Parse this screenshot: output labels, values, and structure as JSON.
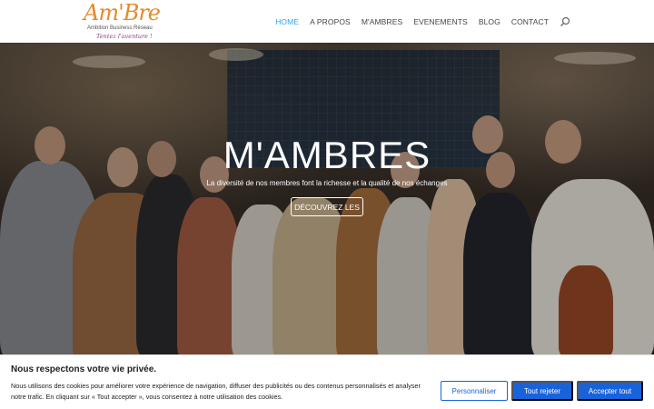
{
  "logo": {
    "script_text": "Am'Bre",
    "line1": "Ambition Business Réseau",
    "line2": "Tentez l'aventure !"
  },
  "nav": {
    "items": [
      {
        "label": "HOME",
        "active": true
      },
      {
        "label": "A PROPOS",
        "active": false
      },
      {
        "label": "M'AMBRES",
        "active": false
      },
      {
        "label": "EVENEMENTS",
        "active": false
      },
      {
        "label": "BLOG",
        "active": false
      },
      {
        "label": "CONTACT",
        "active": false
      }
    ],
    "search_icon": "search-icon"
  },
  "hero": {
    "title": "M'AMBRES",
    "subtitle": "La diversité de nos membres font la richesse et la qualité de nos échanges",
    "button_label": "DÉCOUVREZ LES"
  },
  "cookie": {
    "title": "Nous respectons votre vie privée.",
    "text": "Nous utilisons des cookies pour améliorer votre expérience de navigation, diffuser des publicités ou des contenus personnalisés et analyser notre trafic. En cliquant sur « Tout accepter », vous consentez à notre utilisation des cookies.",
    "btn_customize": "Personnaliser",
    "btn_reject": "Tout rejeter",
    "btn_accept": "Accepter tout"
  },
  "colors": {
    "nav_active": "#2ea3f2",
    "cookie_button": "#1863dc",
    "logo_orange": "#e8892a",
    "logo_purple": "#8e3a8a"
  }
}
